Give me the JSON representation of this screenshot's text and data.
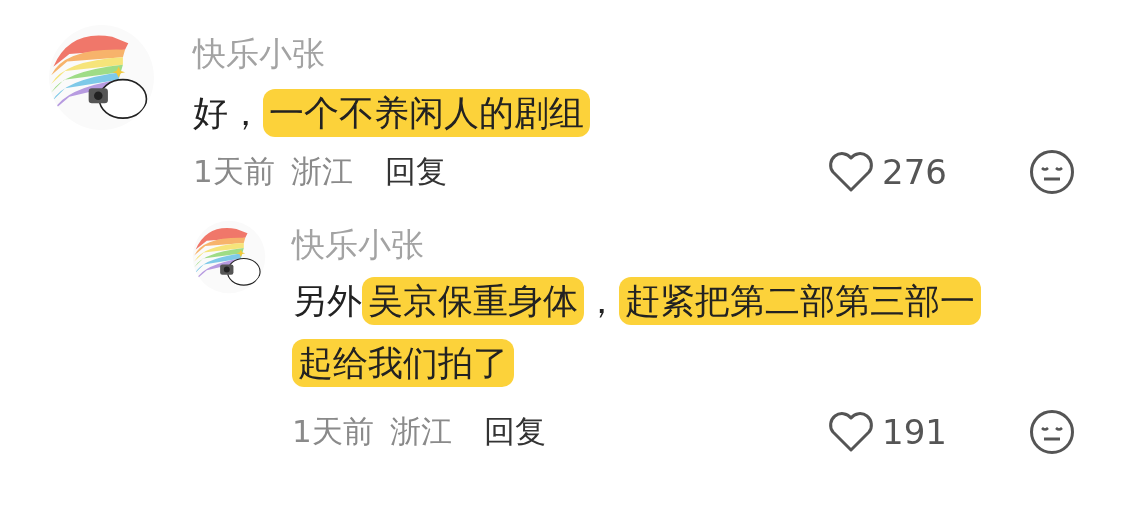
{
  "comments": [
    {
      "author": "快乐小张",
      "segments": [
        {
          "text": "好，",
          "highlighted": false
        },
        {
          "text": "一个不养闲人的剧组",
          "highlighted": true
        }
      ],
      "time": "1天前",
      "location": "浙江",
      "reply_label": "回复",
      "likes": "276",
      "is_reply": false
    },
    {
      "author": "快乐小张",
      "segments": [
        {
          "text": "另外",
          "highlighted": false
        },
        {
          "text": "吴京保重身体",
          "highlighted": true
        },
        {
          "text": "，",
          "highlighted": false
        },
        {
          "text": "赶紧把第二部第三部一起给我们拍了",
          "highlighted": true
        }
      ],
      "time": "1天前",
      "location": "浙江",
      "reply_label": "回复",
      "likes": "191",
      "is_reply": true
    }
  ]
}
